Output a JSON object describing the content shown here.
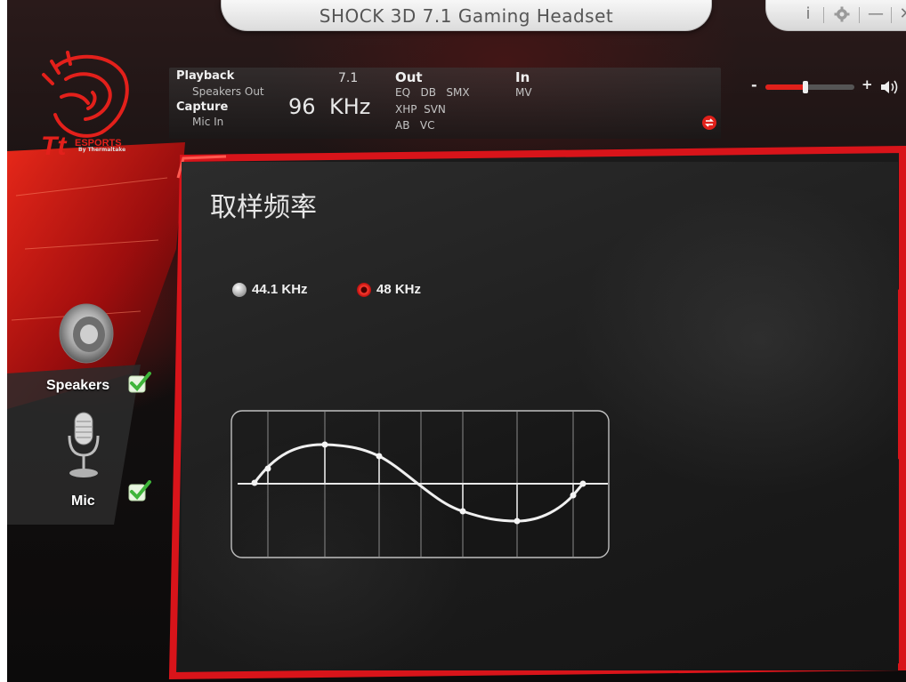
{
  "window": {
    "title": "SHOCK 3D 7.1 Gaming Headset",
    "controls": {
      "info": "i",
      "settings": "gear-icon",
      "minimize": "—",
      "close": "✕"
    }
  },
  "brand": {
    "logo_icon": "tt-dragon-logo",
    "sub": "By Thermaltake"
  },
  "info_panel": {
    "playback_label": "Playback",
    "playback_sub": "Speakers Out",
    "capture_label": "Capture",
    "capture_sub": "Mic In",
    "channels": "7.1",
    "rate": "96",
    "rate_unit": "KHz",
    "out_label": "Out",
    "out_row1": "EQ   DB   SMX",
    "out_row2": "XHP  SVN",
    "out_row3": "AB   VC",
    "in_label": "In",
    "in_row1": "MV"
  },
  "volume": {
    "minus": "-",
    "plus": "+",
    "level": 0.45
  },
  "sidebar": {
    "items": [
      {
        "label": "Speakers",
        "icon": "speaker-icon",
        "checked": true
      },
      {
        "label": "Mic",
        "icon": "microphone-icon",
        "checked": true
      }
    ]
  },
  "main": {
    "title": "取样频率",
    "options": [
      {
        "label": "44.1 KHz",
        "selected": false
      },
      {
        "label": "48 KHz",
        "selected": true
      }
    ],
    "wave_icon": "sine-wave-graph"
  },
  "colors": {
    "accent": "#e0201a",
    "panel": "#1e1e1e"
  }
}
